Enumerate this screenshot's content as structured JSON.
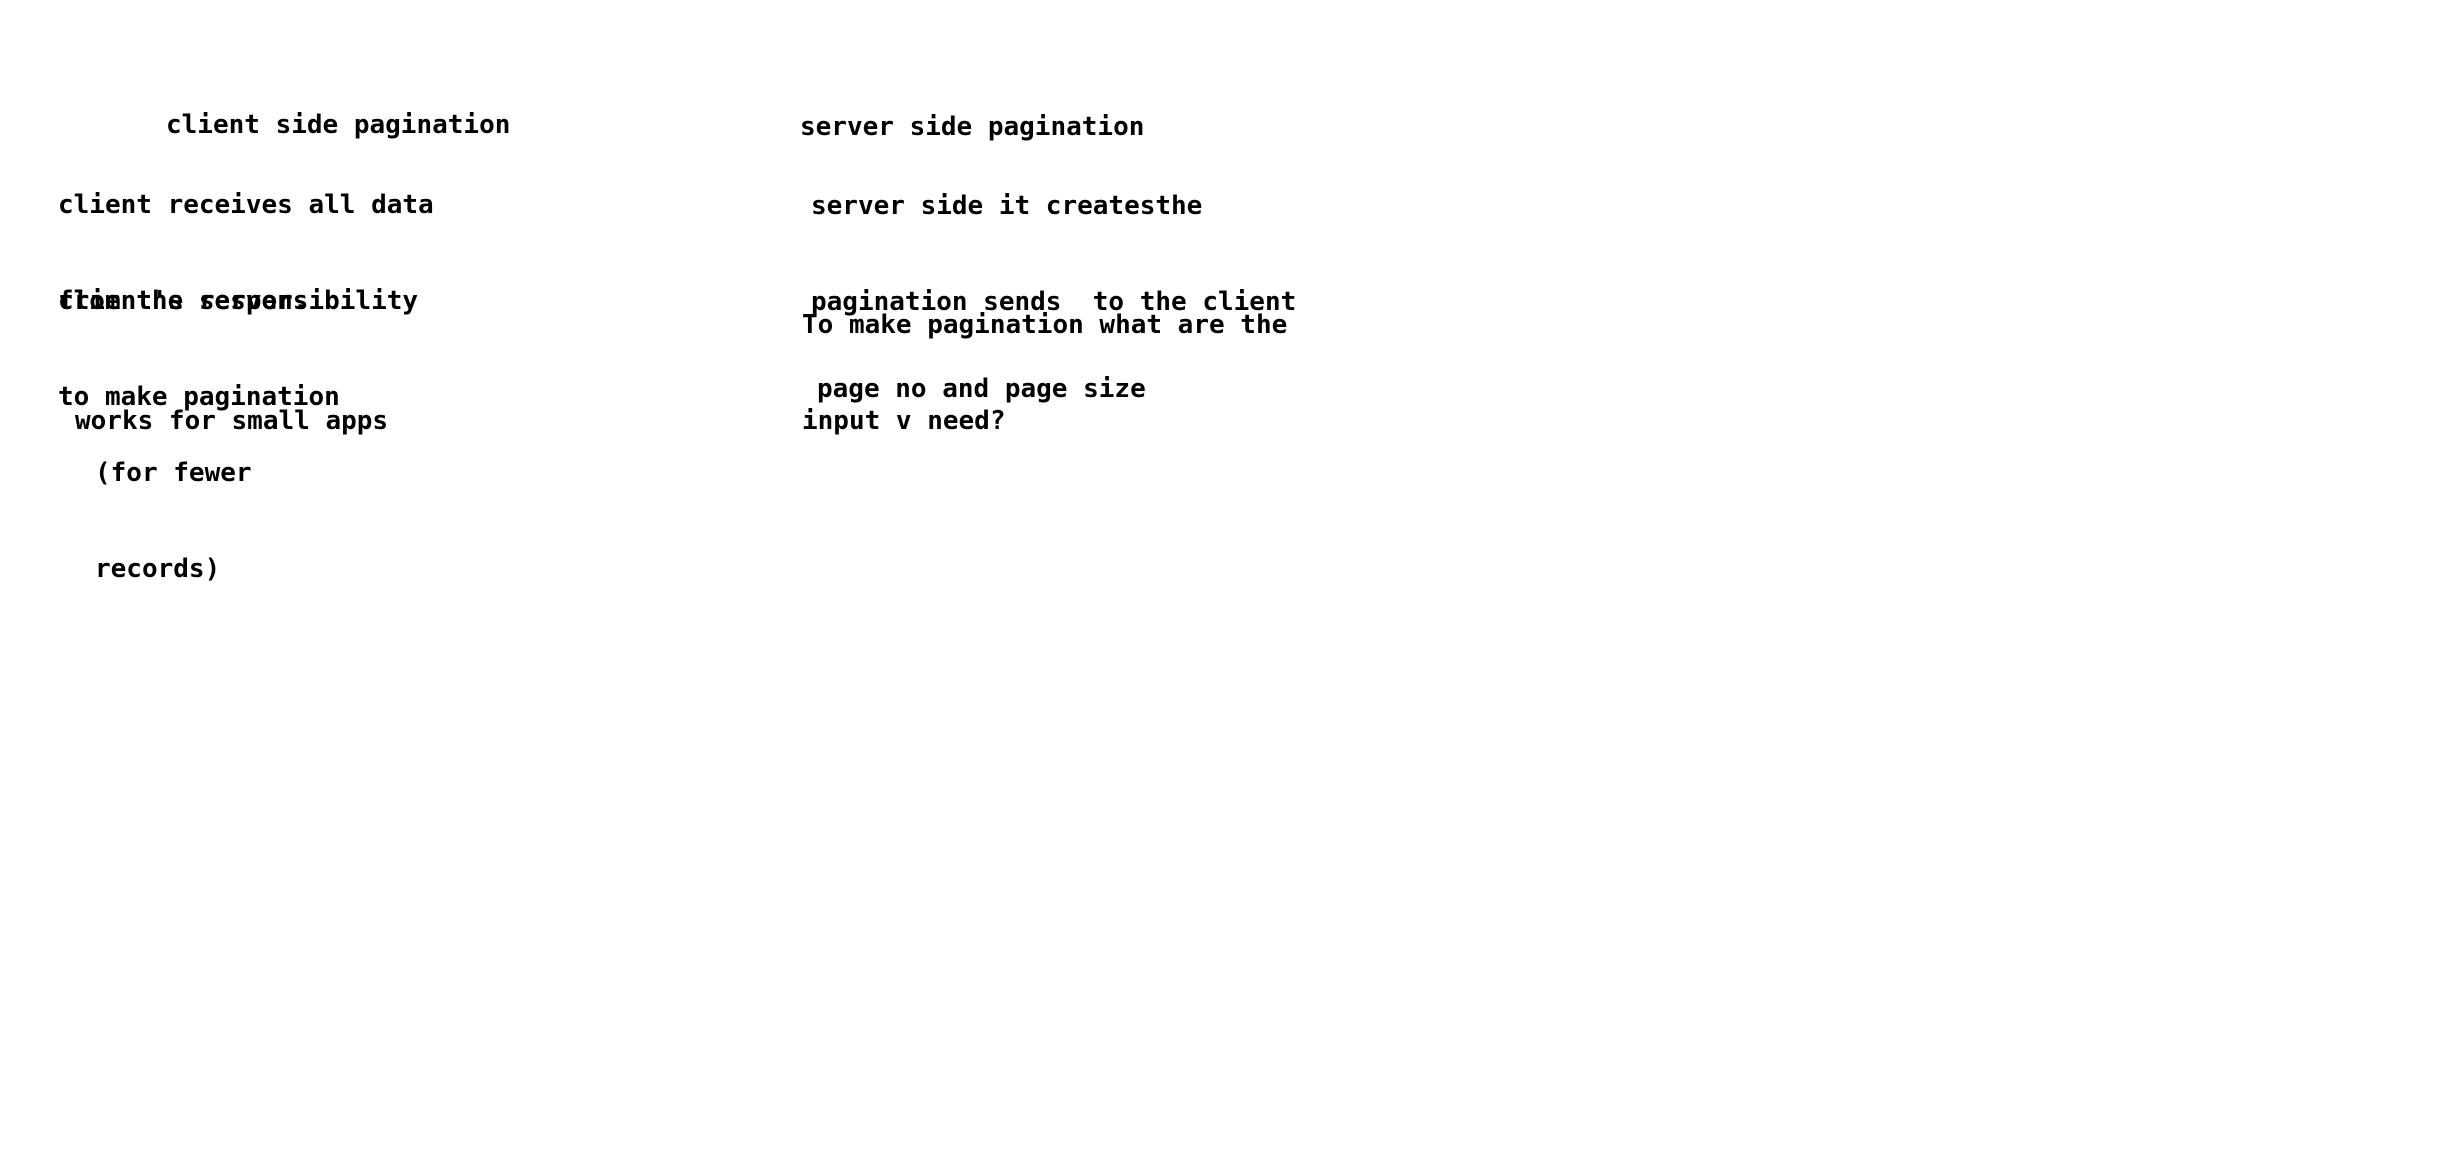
{
  "client": {
    "title": "client side pagination",
    "receives": [
      "client receives all data",
      "from the server."
    ],
    "responsibility": [
      "client's responsibility",
      "to make pagination"
    ],
    "works": "works for small apps",
    "fewer": [
      "(for fewer",
      "records)"
    ]
  },
  "server": {
    "title": "server side pagination",
    "creates": [
      "server side it createsthe",
      "pagination sends  to the client"
    ],
    "question": [
      "To make pagination what are the",
      "input v need?"
    ],
    "answer": "page no and page size"
  }
}
